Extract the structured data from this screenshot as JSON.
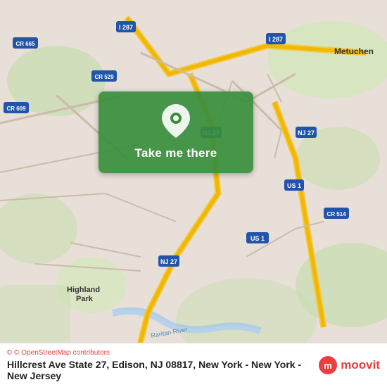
{
  "map": {
    "alt": "Map of Edison NJ area showing Hillcrest Ave State 27",
    "center_lat": 40.5148,
    "center_lng": -74.3654
  },
  "button": {
    "label": "Take me there",
    "bg_color": "#388e3c"
  },
  "bottom_bar": {
    "osm_credit": "© OpenStreetMap contributors",
    "address": "Hillcrest Ave State 27, Edison, NJ 08817, New York - New York - New Jersey",
    "moovit_label": "moovit"
  },
  "icons": {
    "location_pin": "location-pin-icon",
    "moovit_logo": "moovit-logo-icon"
  }
}
